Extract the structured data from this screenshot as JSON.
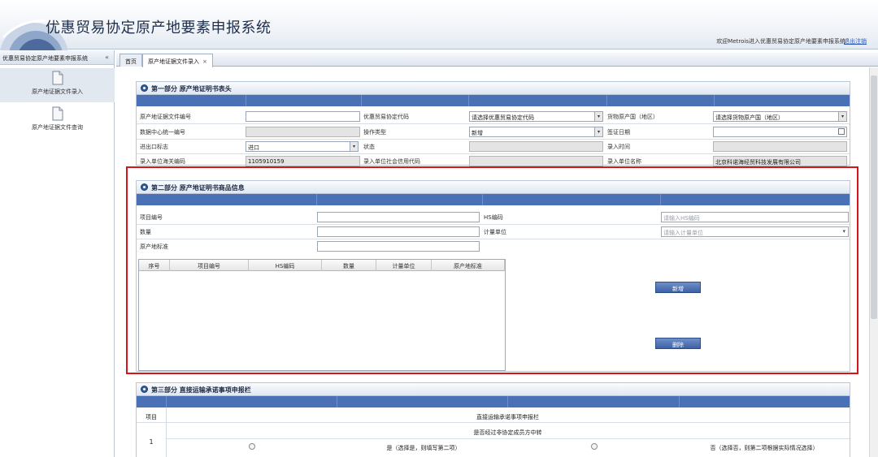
{
  "header": {
    "title": "优惠贸易协定原产地要素申报系统",
    "welcome": "欢迎Metrois进入优惠贸易协定原产地要素申报系统",
    "logout": "退出注销"
  },
  "sidebar": {
    "title": "优惠贸易协定原产地要素申报系统",
    "collapse_icon": "double-chevron",
    "items": [
      {
        "label": "原产地证据文件录入",
        "icon": "document-icon"
      },
      {
        "label": "原产地证据文件查询",
        "icon": "document-icon"
      }
    ]
  },
  "tabs": [
    {
      "label": "首页"
    },
    {
      "label": "原产地证据文件录入",
      "close": "×"
    }
  ],
  "section1": {
    "title": "第一部分 原产地证明书表头",
    "fields": {
      "doc_no_label": "原产地证据文件编号",
      "doc_no_value": "",
      "agreement_label": "优惠贸易协定代码",
      "agreement_value": "请选择优惠贸易协定代码",
      "origin_country_label": "货物原产国（地区）",
      "origin_country_value": "请选择货物原产国（地区）",
      "data_center_label": "数据中心统一编号",
      "data_center_value": "",
      "op_type_label": "操作类型",
      "op_type_value": "新增",
      "issue_date_label": "签证日期",
      "issue_date_value": "",
      "ie_flag_label": "进出口标志",
      "ie_flag_value": "进口",
      "status_label": "状态",
      "status_value": "",
      "entry_time_label": "录入时间",
      "entry_time_value": "",
      "unit_customs_label": "录入单位海关编码",
      "unit_customs_value": "1105910159",
      "unit_credit_label": "录入单位社会信用代码",
      "unit_credit_value": "",
      "unit_name_label": "录入单位名称",
      "unit_name_value": "北京科诺海经贸科技发展有限公司"
    }
  },
  "section2": {
    "title": "第二部分 原产地证明书商品信息",
    "fields": {
      "item_no_label": "项目编号",
      "item_no_value": "",
      "hs_label": "HS编码",
      "hs_placeholder": "请输入HS编码",
      "qty_label": "数量",
      "qty_value": "",
      "unit_label": "计量单位",
      "unit_placeholder": "请输入计量单位",
      "criteria_label": "原产地标准",
      "criteria_value": ""
    },
    "grid_columns": [
      "序号",
      "项目编号",
      "HS编码",
      "数量",
      "计量单位",
      "原产地标准"
    ],
    "grid_rows": [],
    "buttons": {
      "add": "新增",
      "delete": "删除"
    }
  },
  "section3": {
    "title": "第三部分 直接运输承诺事项申报栏",
    "col_item": "项目",
    "heading": "直接运输承诺事项申报栏",
    "row_no": "1",
    "question": "是否经过非协定成员方中转",
    "option_yes": "是（选择是，则填写第二项）",
    "option_no": "否（选择否，则第二项根据实际情况选择）"
  },
  "colors": {
    "band": "#4a70b5",
    "button": "#3d62a6",
    "highlight": "#d4161c"
  }
}
